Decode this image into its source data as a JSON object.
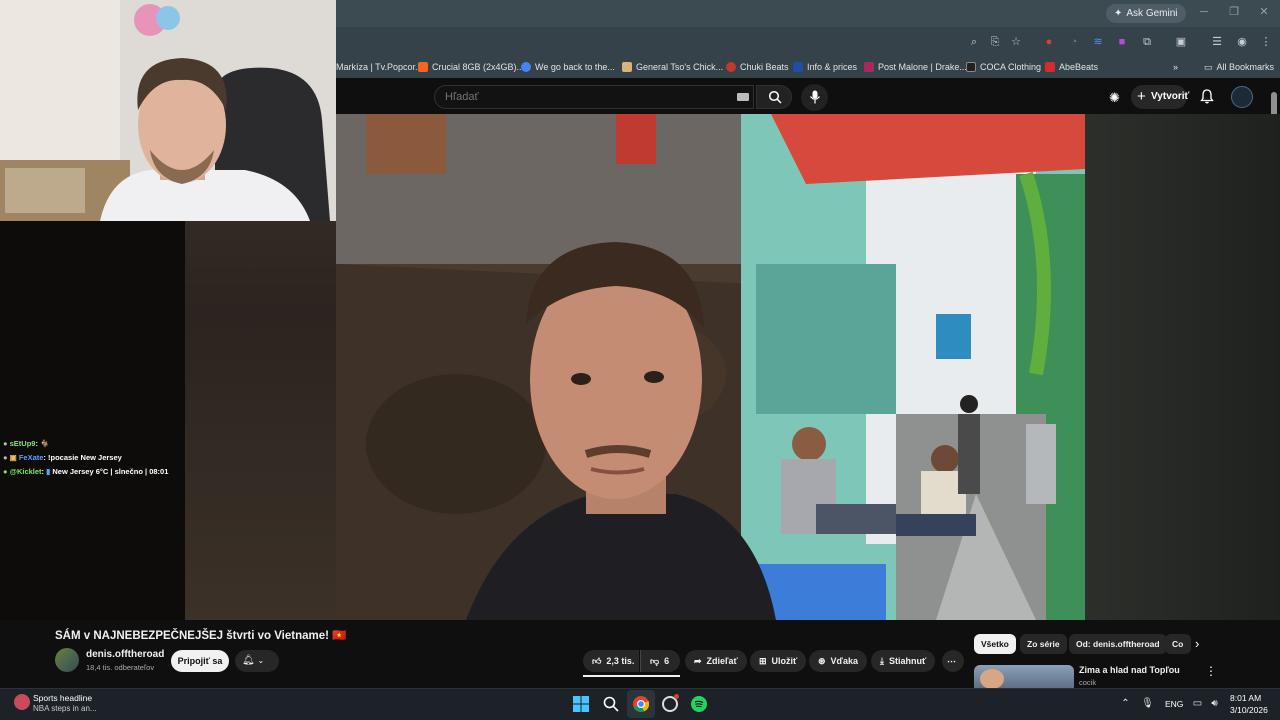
{
  "browser": {
    "ask_gemini": "Ask Gemini",
    "bookmarks": [
      {
        "label": "Markíza | Tv.Popcor...",
        "color": "#e33b2e"
      },
      {
        "label": "Crucial 8GB (2x4GB)...",
        "color": "#f26522"
      },
      {
        "label": "We go back to the...",
        "color": "#4285f4"
      },
      {
        "label": "General Tso's Chick...",
        "color": "#d5b47a"
      },
      {
        "label": "Chuki Beats",
        "color": "#c0392b"
      },
      {
        "label": "Info & prices",
        "color": "#1f4ea5"
      },
      {
        "label": "Post Malone | Drake...",
        "color": "#a52a5a"
      },
      {
        "label": "COCA Clothing",
        "color": "#222"
      },
      {
        "label": "AbeBeats",
        "color": "#d42b2b"
      }
    ],
    "all_bookmarks": "All Bookmarks"
  },
  "youtube": {
    "search_placeholder": "Hľadať",
    "create_label": "Vytvoriť",
    "video_title": "SÁM v NAJNEBEZPEČNEJŠEJ štvrti vo Vietname! 🇻🇳",
    "title_suffix": "VN",
    "channel_name": "denis.offtheroad",
    "channel_subs": "18,4 tis. odberateľov",
    "join_label": "Pripojiť sa",
    "likes": "2,3 tis.",
    "dislikes": "6",
    "share_label": "Zdieľať",
    "save_label": "Uložiť",
    "thanks_label": "Vďaka",
    "download_label": "Stiahnuť",
    "chips": [
      "Všetko",
      "Zo série",
      "Od: denis.offtheroad",
      "Co"
    ],
    "rec_title": "Zima a hlad nad Topľou",
    "rec_channel": "cocik"
  },
  "chat": {
    "lines": [
      {
        "user": "sEtUp9",
        "text": "",
        "color": "#8ee07e"
      },
      {
        "user": "FeXate",
        "text": "!pocasie New Jersey",
        "color": "#5aa0ff"
      },
      {
        "user": "@Kicklet",
        "text": "New Jersey 6°C |  slnečno |  08:01",
        "color": "#7ee85a"
      }
    ]
  },
  "taskbar": {
    "news_title": "Sports headline",
    "news_sub": "NBA steps in an...",
    "lang": "ENG",
    "time": "8:01 AM",
    "date": "3/10/2026"
  }
}
